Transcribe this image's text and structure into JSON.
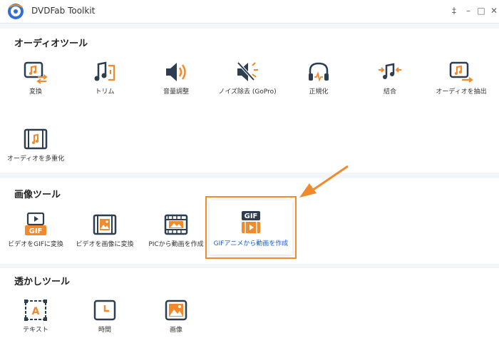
{
  "window": {
    "title": "DVDFab Toolkit",
    "controls": [
      "‡",
      "–",
      "□",
      "✕"
    ]
  },
  "colors": {
    "accent": "#f08a2c",
    "icon_dark": "#2c3e50",
    "active_text": "#1a5fc0"
  },
  "audio": {
    "title": "オーディオツール",
    "tools": [
      {
        "label": "変換",
        "icon": "audio-convert-icon"
      },
      {
        "label": "トリム",
        "icon": "audio-trim-icon"
      },
      {
        "label": "音量調整",
        "icon": "volume-icon"
      },
      {
        "label": "ノイズ除去 (GoPro)",
        "icon": "noise-removal-icon"
      },
      {
        "label": "正規化",
        "icon": "normalize-icon"
      },
      {
        "label": "結合",
        "icon": "merge-icon"
      },
      {
        "label": "オーディオを抽出",
        "icon": "extract-audio-icon"
      },
      {
        "label": "オーディオを多重化",
        "icon": "multiplex-audio-icon"
      }
    ]
  },
  "image": {
    "title": "画像ツール",
    "tools": [
      {
        "label": "ビデオをGIFに変換",
        "icon": "video-to-gif-icon"
      },
      {
        "label": "ビデオを画像に変換",
        "icon": "video-to-image-icon"
      },
      {
        "label": "PICから動画を作成",
        "icon": "pic-to-video-icon"
      },
      {
        "label": "GIFアニメから動画を作成",
        "icon": "gif-to-video-icon"
      }
    ],
    "gif_text": "GIF"
  },
  "watermark": {
    "title": "透かしツール",
    "tools": [
      {
        "label": "テキスト",
        "icon": "text-watermark-icon"
      },
      {
        "label": "時間",
        "icon": "time-watermark-icon"
      },
      {
        "label": "画像",
        "icon": "image-watermark-icon"
      }
    ],
    "text_glyph": "A"
  }
}
